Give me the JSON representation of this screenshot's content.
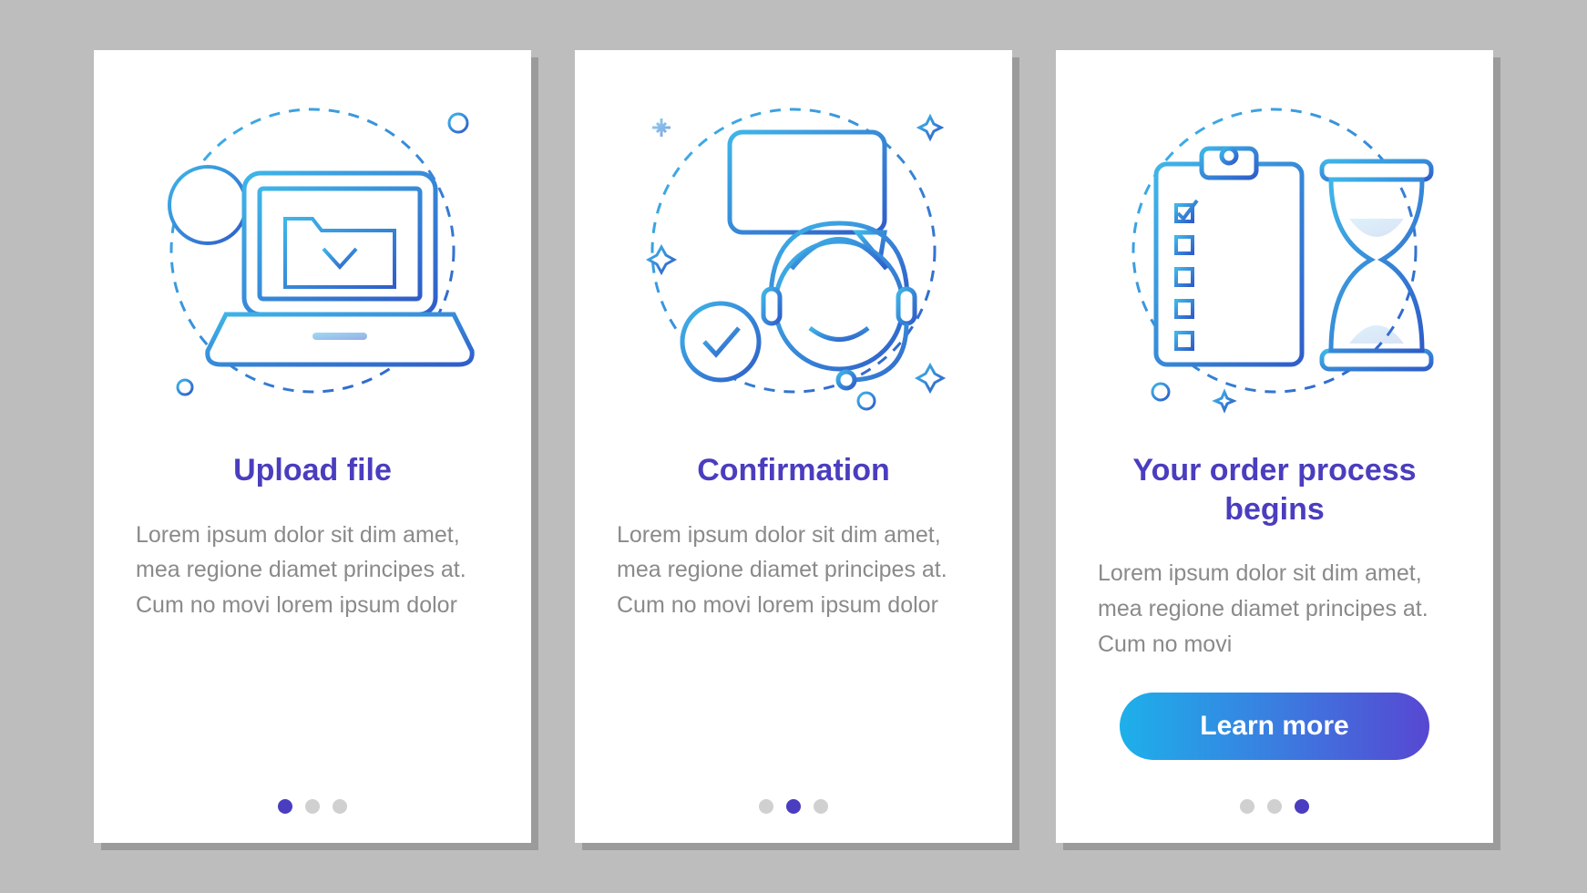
{
  "colors": {
    "accent": "#4b3dbf",
    "text_muted": "#8a8a8a",
    "gradient_start": "#1db0ea",
    "gradient_end": "#5747d2",
    "stroke_light": "#3fb6e8",
    "stroke_dark": "#2f5dc9"
  },
  "cards": [
    {
      "icon": "laptop-download-clock",
      "title": "Upload file",
      "description": "Lorem ipsum dolor sit dim amet, mea regione diamet principes at. Cum no movi lorem ipsum dolor",
      "active_dot": 0
    },
    {
      "icon": "support-agent-chat-check",
      "title": "Confirmation",
      "description": "Lorem ipsum dolor sit dim amet, mea regione diamet principes at. Cum no movi lorem ipsum dolor",
      "active_dot": 1
    },
    {
      "icon": "clipboard-checklist-hourglass",
      "title": "Your order process begins",
      "description": "Lorem ipsum dolor sit dim amet, mea regione diamet principes at. Cum no movi",
      "cta": "Learn more",
      "active_dot": 2
    }
  ]
}
